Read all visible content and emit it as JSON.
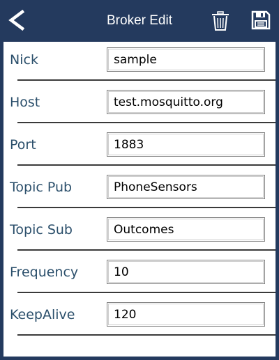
{
  "header": {
    "title": "Broker Edit",
    "back_icon": "back-arrow-icon",
    "delete_icon": "trash-icon",
    "save_icon": "floppy-disk-icon"
  },
  "fields": [
    {
      "label": "Nick",
      "value": "sample"
    },
    {
      "label": "Host",
      "value": "test.mosquitto.org"
    },
    {
      "label": "Port",
      "value": "1883"
    },
    {
      "label": "Topic Pub",
      "value": "PhoneSensors"
    },
    {
      "label": "Topic Sub",
      "value": "Outcomes"
    },
    {
      "label": "Frequency",
      "value": "10"
    },
    {
      "label": "KeepAlive",
      "value": "120"
    }
  ],
  "colors": {
    "header_bg": "#243a5e",
    "label_text": "#2b4f6b"
  }
}
